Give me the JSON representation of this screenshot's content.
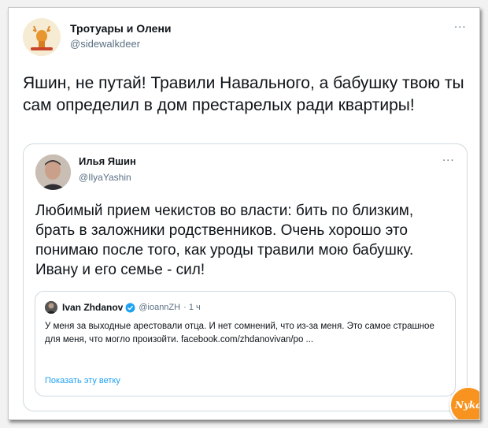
{
  "tweet": {
    "author_name": "Тротуары и Олени",
    "author_handle": "@sidewalkdeer",
    "more": "...",
    "text": "Яшин, не путай! Травили Навального, а бабушку твою ты сам определил в дом престарелых ради квартиры!"
  },
  "quoted": {
    "author_name": "Илья Яшин",
    "author_handle": "@IlyaYashin",
    "more": "...",
    "text": "Любимый прием чекистов во власти: бить по близким, брать в заложники родственников. Очень хорошо это понимаю после того, как уроды травили мою бабушку. Ивану и его семье - сил!"
  },
  "nested_quoted": {
    "author_name": "Ivan Zhdanov",
    "author_handle": "@ioannZH",
    "time": "· 1 ч",
    "text": "У меня за выходные арестовали отца. И нет сомнений, что из-за меня. Это самое страшное для меня, что могло произойти. facebook.com/zhdanovivan/po ...",
    "show_thread": "Показать эту ветку"
  },
  "watermark": {
    "text": "Nyka",
    "color": "#f7931e"
  },
  "colors": {
    "link": "#1da1f2",
    "muted": "#5b7083",
    "border": "#cfd9de"
  }
}
